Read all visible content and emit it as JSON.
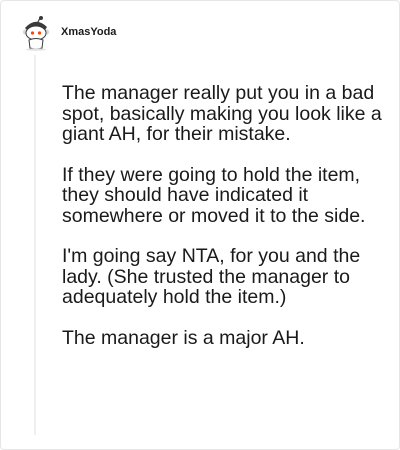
{
  "comment": {
    "author": "XmasYoda",
    "paragraphs": [
      "The manager really put you in a bad spot, basically making you look like a giant AH, for their mistake.",
      "If they were going to hold the item, they should have indicated it somewhere or moved it to the side.",
      "I'm going say NTA, for you and the lady. (She trusted the manager to adequately hold the item.)",
      "The manager is a major AH."
    ]
  },
  "icons": {
    "avatar": "reddit-snoo-avatar-icon"
  }
}
